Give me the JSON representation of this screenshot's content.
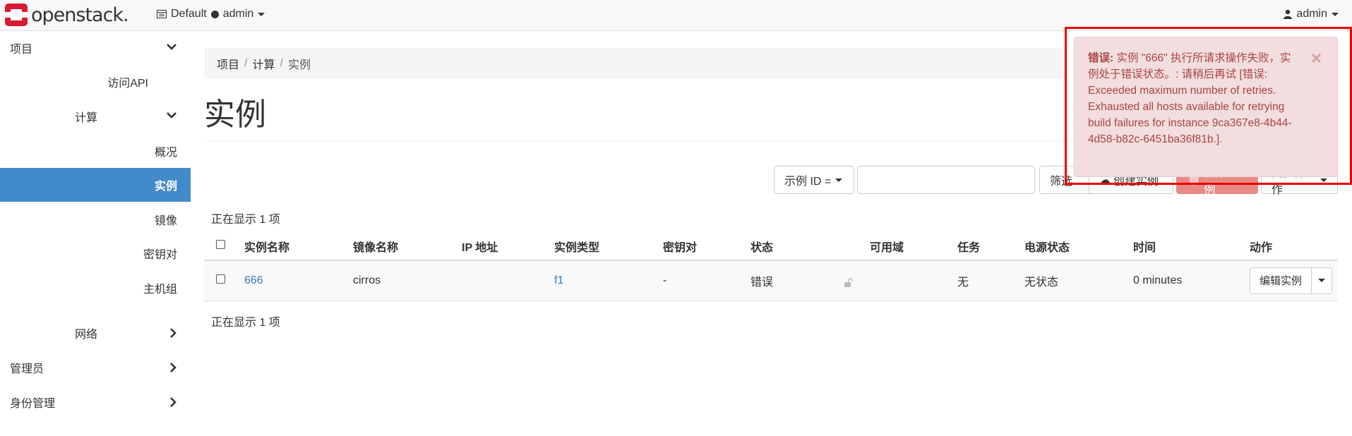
{
  "brand": {
    "logo_text": "openstack.",
    "logo_color": "#da1a32"
  },
  "navbar": {
    "project_domain": "Default",
    "project_name": "admin",
    "user": "admin"
  },
  "sidebar": {
    "items": [
      {
        "label": "项目",
        "icon": "chevron-down-icon"
      },
      {
        "label": "访问API"
      },
      {
        "label": "计算",
        "icon": "chevron-down-icon"
      },
      {
        "label": "概况"
      },
      {
        "label": "实例",
        "active": true
      },
      {
        "label": "镜像"
      },
      {
        "label": "密钥对"
      },
      {
        "label": "主机组"
      },
      {
        "label": "网络",
        "icon": "chevron-right-icon"
      },
      {
        "label": "管理员",
        "icon": "chevron-right-icon"
      },
      {
        "label": "身份管理",
        "icon": "chevron-right-icon"
      }
    ],
    "active_color": "#428bca"
  },
  "breadcrumb": [
    "项目",
    "计算",
    "实例"
  ],
  "page": {
    "title": "实例"
  },
  "toolbar": {
    "filter_select": "示例 ID =",
    "filter_value": "",
    "filter_button": "筛选",
    "create_button": "创建实例",
    "delete_button": "删除实例",
    "more_button": "更多操作"
  },
  "table": {
    "count_top": "正在显示 1 项",
    "count_bottom": "正在显示 1 项",
    "headers": [
      "实例名称",
      "镜像名称",
      "IP 地址",
      "实例类型",
      "密钥对",
      "状态",
      "可用域",
      "任务",
      "电源状态",
      "时间",
      "动作"
    ],
    "rows": [
      {
        "name": "666",
        "image": "cirros",
        "ip": "",
        "flavor": "f1",
        "keypair": "-",
        "status": "错误",
        "az": "",
        "task": "无",
        "power": "无状态",
        "time": "0 minutes",
        "action": "编辑实例"
      }
    ]
  },
  "alert": {
    "label": "错误:",
    "message": "实例 \"666\" 执行所请求操作失败，实例处于错误状态。: 请稍后再试 [错误: Exceeded maximum number of retries. Exhausted all hosts available for retrying build failures for instance 9ca367e8-4b44-4d58-b82c-6451ba36f81b.].",
    "close": "×"
  }
}
